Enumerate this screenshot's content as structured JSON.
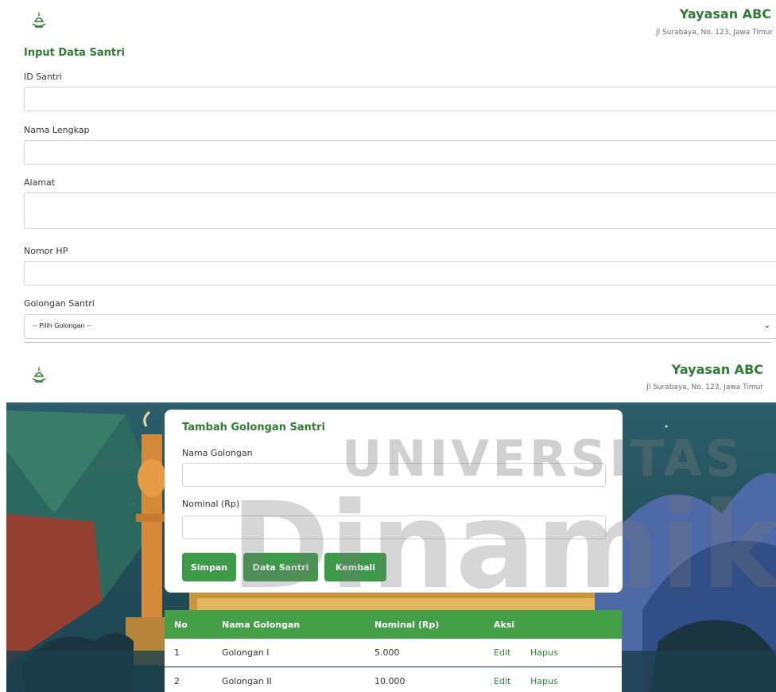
{
  "top": {
    "org_name": "Yayasan ABC",
    "org_address": "Jl Surabaya, No. 123, Jawa Timur",
    "form_title": "Input Data Santri",
    "fields": [
      {
        "label": "ID Santri",
        "value": ""
      },
      {
        "label": "Nama Lengkap",
        "value": ""
      },
      {
        "label": "Alamat",
        "value": ""
      },
      {
        "label": "Nomor HP",
        "value": ""
      },
      {
        "label": "Golongan Santri",
        "value": "-- Pilih Golongan --"
      }
    ]
  },
  "bottom": {
    "org_name": "Yayasan ABC",
    "org_address": "Jl Surabaya, No. 123, Jawa Timur",
    "card_title": "Tambah Golongan Santri",
    "fields": [
      {
        "label": "Nama Golongan",
        "value": ""
      },
      {
        "label": "Nominal (Rp)",
        "value": ""
      }
    ],
    "buttons": {
      "save": "Simpan",
      "data_santri": "Data Santri",
      "back": "Kembali"
    },
    "table": {
      "headers": [
        "No",
        "Nama Golongan",
        "Nominal (Rp)",
        "Aksi"
      ],
      "rows": [
        {
          "no": "1",
          "name": "Golongan I",
          "nominal": "5.000",
          "edit": "Edit",
          "delete": "Hapus"
        },
        {
          "no": "2",
          "name": "Golongan II",
          "nominal": "10.000",
          "edit": "Edit",
          "delete": "Hapus"
        }
      ]
    }
  },
  "watermark": {
    "line1": "UNIVERSITAS",
    "line2": "Dinamika"
  },
  "colors": {
    "brand_green": "#2e7d32",
    "button_green": "#3c9a48",
    "table_header": "#43a047",
    "scene_teal": "#23505b"
  },
  "icons": {
    "logo": "mosque-dome-logo-icon",
    "select_arrow": "chevron-down-icon"
  }
}
